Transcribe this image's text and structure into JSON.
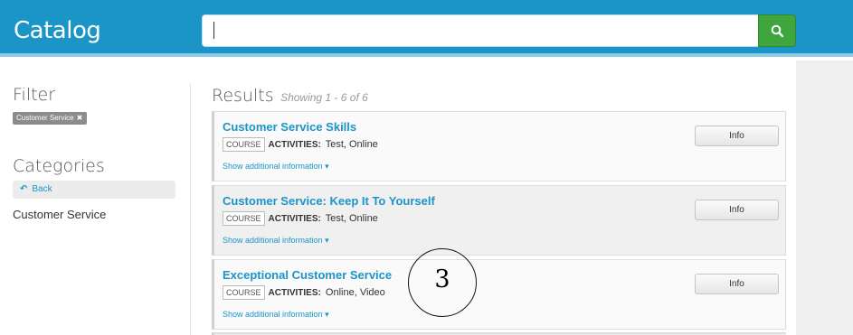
{
  "header": {
    "title": "Catalog",
    "search": {
      "value": "",
      "placeholder": ""
    },
    "search_icon": "search-icon",
    "colors": {
      "bar": "#1b95c8",
      "search_button": "#3fa63f"
    }
  },
  "sidebar": {
    "filter_title": "Filter",
    "active_filter": "Customer Service",
    "remove_icon": "close-icon",
    "categories_title": "Categories",
    "back_label": "Back",
    "back_icon": "reply-arrow-icon",
    "category": "Customer Service"
  },
  "results": {
    "title": "Results",
    "count_text": "Showing 1 - 6 of 6",
    "items": [
      {
        "title": "Customer Service Skills",
        "type": "COURSE",
        "activities_label": "ACTIVITIES:",
        "activities": "Test, Online",
        "more": "Show additional information",
        "info": "Info"
      },
      {
        "title": "Customer Service: Keep It To Yourself",
        "type": "COURSE",
        "activities_label": "ACTIVITIES:",
        "activities": "Test, Online",
        "more": "Show additional information",
        "info": "Info"
      },
      {
        "title": "Exceptional Customer Service",
        "type": "COURSE",
        "activities_label": "ACTIVITIES:",
        "activities": "Online, Video",
        "more": "Show additional information",
        "info": "Info"
      }
    ]
  },
  "annotation": {
    "step": "3"
  }
}
